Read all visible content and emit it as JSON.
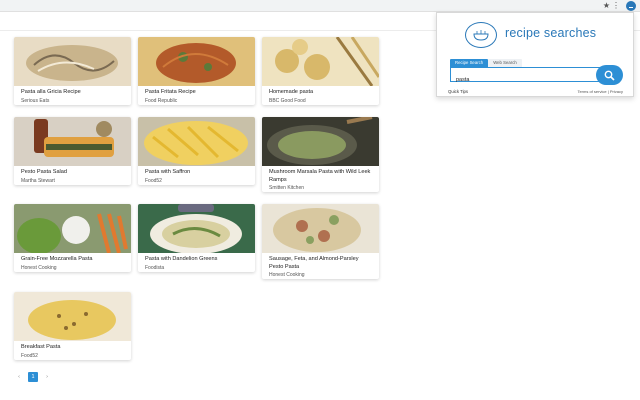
{
  "browser": {
    "star_glyph": "★",
    "menu_glyph": "⋮"
  },
  "popup": {
    "brand": "recipe searches",
    "tabs": [
      {
        "label": "Recipe Search",
        "active": true
      },
      {
        "label": "Web Search",
        "active": false
      }
    ],
    "search_value": "pasta",
    "quick_tips": "Quick Tips",
    "terms": "Terms of service",
    "separator": "|",
    "privacy": "Privacy"
  },
  "results": [
    {
      "title": "Pasta alla Gricia Recipe",
      "source": "Serious Eats",
      "img": [
        "#e8dcc5",
        "#c9b48c",
        "#7a6a52"
      ]
    },
    {
      "title": "Pasta Fritata Recipe",
      "source": "Food Republic",
      "img": [
        "#b35a2a",
        "#5b7a3a",
        "#e0c07a"
      ]
    },
    {
      "title": "Homemade pasta",
      "source": "BBC Good Food",
      "img": [
        "#efe3c0",
        "#d8b86a",
        "#9a7a40"
      ]
    },
    {
      "title": "Pesto Pasta Salad",
      "source": "Martha Stewart",
      "img": [
        "#7a3a20",
        "#e0a040",
        "#4a5a30"
      ]
    },
    {
      "title": "Pasta with Saffron",
      "source": "Food52",
      "img": [
        "#f0d060",
        "#e4b830",
        "#c8c0a8"
      ]
    },
    {
      "title": "Mushroom Marsala Pasta with Wild Leek Ramps",
      "source": "Smitten Kitchen",
      "img": [
        "#5a5a4a",
        "#8a9a60",
        "#3a3a30"
      ]
    },
    {
      "title": "Grain-Free Mozzarella Pasta",
      "source": "Honest Cooking",
      "img": [
        "#6a9a3a",
        "#f0f0ec",
        "#e07a30"
      ]
    },
    {
      "title": "Pasta with Dandelion Greens",
      "source": "Foodista",
      "img": [
        "#3a6a4a",
        "#d8d0a0",
        "#6a8a40"
      ]
    },
    {
      "title": "Sausage, Feta, and Almond-Parsley Pesto Pasta",
      "source": "Honest Cooking",
      "img": [
        "#8aa060",
        "#d8c8a0",
        "#b07050"
      ]
    },
    {
      "title": "Breakfast Pasta",
      "source": "Food52",
      "img": [
        "#f0e8d8",
        "#e8c860",
        "#8a6a30"
      ]
    }
  ],
  "pagination": {
    "prev": "‹",
    "current": "1",
    "next": "›"
  }
}
